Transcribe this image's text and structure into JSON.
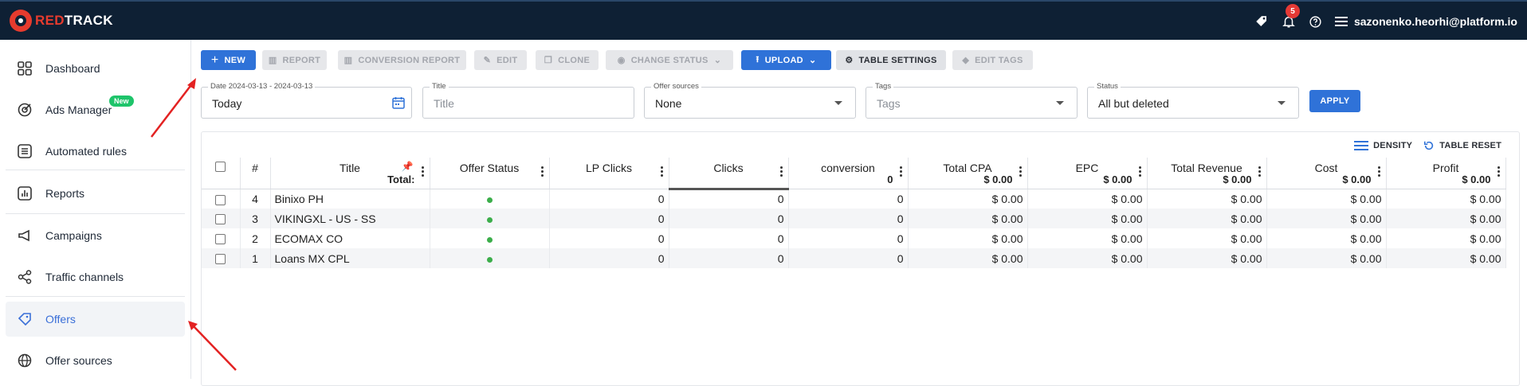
{
  "brand": {
    "part1": "RED",
    "part2": "TRACK"
  },
  "topbar": {
    "notifications": "5",
    "user": "sazonenko.heorhi@platform.io"
  },
  "sidebar": {
    "items": [
      {
        "label": "Dashboard",
        "icon": "grid-icon"
      },
      {
        "label": "Ads Manager",
        "icon": "target-icon",
        "badge": "New"
      },
      {
        "label": "Automated rules",
        "icon": "list-icon"
      },
      {
        "label": "Reports",
        "icon": "chart-icon"
      },
      {
        "label": "Campaigns",
        "icon": "megaphone-icon"
      },
      {
        "label": "Traffic channels",
        "icon": "network-icon"
      },
      {
        "label": "Offers",
        "icon": "tag-icon",
        "active": true
      },
      {
        "label": "Offer sources",
        "icon": "globe-icon"
      }
    ]
  },
  "toolbar": {
    "new": "NEW",
    "report": "REPORT",
    "conversion_report": "CONVERSION REPORT",
    "edit": "EDIT",
    "clone": "CLONE",
    "change_status": "CHANGE STATUS",
    "upload": "UPLOAD",
    "table_settings": "TABLE SETTINGS",
    "edit_tags": "EDIT TAGS"
  },
  "filters": {
    "date": {
      "label": "Date 2024-03-13 - 2024-03-13",
      "value": "Today"
    },
    "title": {
      "label": "Title",
      "placeholder": "Title"
    },
    "offer_sources": {
      "label": "Offer sources",
      "value": "None"
    },
    "tags": {
      "label": "Tags",
      "placeholder": "Tags"
    },
    "status": {
      "label": "Status",
      "value": "All but deleted"
    },
    "apply": "APPLY"
  },
  "table_tools": {
    "density": "DENSITY",
    "reset": "TABLE RESET"
  },
  "table": {
    "headers": {
      "num": "#",
      "title": "Title",
      "total_label": "Total:",
      "offer_status": "Offer Status",
      "lp_clicks": "LP Clicks",
      "clicks": "Clicks",
      "conversion": "conversion",
      "conversion_total": "0",
      "total_cpa": "Total CPA",
      "total_cpa_total": "$ 0.00",
      "epc": "EPC",
      "epc_total": "$ 0.00",
      "total_revenue": "Total Revenue",
      "total_revenue_total": "$ 0.00",
      "cost": "Cost",
      "cost_total": "$ 0.00",
      "profit": "Profit",
      "profit_total": "$ 0.00"
    },
    "rows": [
      {
        "num": "4",
        "title": "Binixo PH",
        "lp": "0",
        "clicks": "0",
        "conv": "0",
        "cpa": "$ 0.00",
        "epc": "$ 0.00",
        "rev": "$ 0.00",
        "cost": "$ 0.00",
        "profit": "$ 0.00"
      },
      {
        "num": "3",
        "title": "VIKINGXL - US - SS",
        "lp": "0",
        "clicks": "0",
        "conv": "0",
        "cpa": "$ 0.00",
        "epc": "$ 0.00",
        "rev": "$ 0.00",
        "cost": "$ 0.00",
        "profit": "$ 0.00"
      },
      {
        "num": "2",
        "title": "ECOMAX CO",
        "lp": "0",
        "clicks": "0",
        "conv": "0",
        "cpa": "$ 0.00",
        "epc": "$ 0.00",
        "rev": "$ 0.00",
        "cost": "$ 0.00",
        "profit": "$ 0.00"
      },
      {
        "num": "1",
        "title": "Loans MX CPL",
        "lp": "0",
        "clicks": "0",
        "conv": "0",
        "cpa": "$ 0.00",
        "epc": "$ 0.00",
        "rev": "$ 0.00",
        "cost": "$ 0.00",
        "profit": "$ 0.00"
      }
    ]
  }
}
